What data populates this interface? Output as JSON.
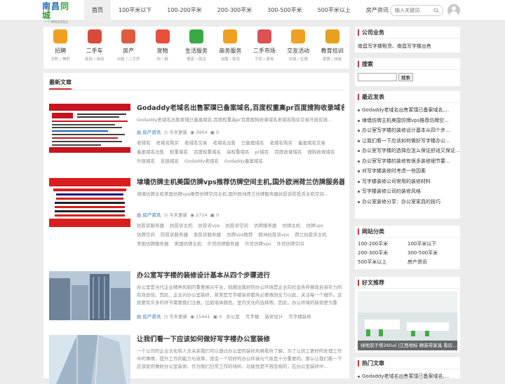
{
  "header": {
    "logo_title_1": "南昌",
    "logo_title_2": "同城",
    "logo_sub": "一个神奇的网站",
    "nav": [
      "首页",
      "100平米以下",
      "100-200平米",
      "200-300平米",
      "300-500平米",
      "500平米以上",
      "房产资讯"
    ],
    "search_placeholder": "输入关键词"
  },
  "categories": [
    {
      "name": "招聘",
      "sub": "全职 / 兼职",
      "color": "#f0a020"
    },
    {
      "name": "二手车",
      "sub": "家用 / 商用",
      "color": "#d84a3a"
    },
    {
      "name": "房产",
      "sub": "出租 / 二手房",
      "color": "#e05a40"
    },
    {
      "name": "宠物",
      "sub": "狗 / 猫",
      "color": "#e8503a"
    },
    {
      "name": "生活服务",
      "sub": "搬家 / 保洁",
      "color": "#3aa845"
    },
    {
      "name": "商务服务",
      "sub": "加盟 / 租赁",
      "color": "#f0a020"
    },
    {
      "name": "二手市场",
      "sub": "手机 / 家电",
      "color": "#e05050"
    },
    {
      "name": "交友活动",
      "sub": "同城 / 征婚",
      "color": "#f0a020"
    },
    {
      "name": "教育培训",
      "sub": "家教 / 技能",
      "color": "#e8a020"
    }
  ],
  "articles_section": "最新文章",
  "articles": [
    {
      "title": "Godaddy老域名出售冢璞已备案域名,百度权重高pr百度搜狗收录域名老...",
      "desc": "Godaddy老域名出售冢璞已备案域名,百度权重高pr百度搜狗收录域名老域名购买交易外链反链...",
      "category": "房产资讯",
      "time": "今天更新",
      "views": "3954",
      "comments": "0",
      "tags": [
        "老域名",
        "老域名购买",
        "老域名交易",
        "老域名出售",
        "已备案域名",
        "老域名购买",
        "备案域名交易",
        "备案域名出售",
        "权重域名",
        "百度权重域名",
        "高权重域名",
        "pr域名",
        "百度收录域名",
        "搜狗收录域名",
        "外链域名",
        "反链域名",
        "Godaddy老域名",
        "Godaddy备案域名"
      ]
    },
    {
      "title": "埭墧仿牌主机美国仿牌vps推荐仿牌空间主机,国外欧洲荷兰仿牌服务器...",
      "desc": "埭墧仿牌主机美国仿牌vps推荐仿牌空间主机,国外欧洲荷兰仿牌服务器抗投诉防投诉主机空间...",
      "category": "房产资讯",
      "time": "今天更新",
      "views": "2714",
      "comments": "0",
      "tags": [
        "抗投诉服务器",
        "抗投诉主机",
        "抗投诉vps",
        "抗投诉空间",
        "仿牌服务器",
        "仿牌主机",
        "仿牌vps",
        "仿牌空间",
        "防投诉服务器",
        "免投诉服务器",
        "仿牌vps推荐",
        "欧洲抗投诉vps",
        "荷兰抗投诉主机",
        "美国仿牌服务器",
        "美国仿牌主机",
        "外贸仿牌服务器",
        "外贸仿牌vps",
        "外贸仿牌空间"
      ]
    },
    {
      "title": "办公室写字楼的装修设计基本从四个步骤进行",
      "desc": "办公室是当代企业精神风貌的重要展示平台，就拥出我好的办公环境是企业向社会各界展现自身实力的有效途径。因此，企业对办公室装修，甚至是写字楼装修都务必要做到全力以赴，关注每一个细节。这就要有许多的环节需要我们注意。比如墙体颜色、室内文化的选择等。因此，办公环境的装修更为重要...",
      "category": "房产资讯",
      "time": "今天更新",
      "views": "15441",
      "comments": "0",
      "tags": [
        "办公室",
        "写字楼",
        "装修设计",
        "写字楼装修"
      ]
    },
    {
      "title": "让我们看一下应该如何做好写字楼办公室装修",
      "desc": "一个公司的企业文化和人文关系我们可以透过办公室的装修风格看所了解，为了让员工更好的处理工作中的事情，提升工作的能力与效率，营造一个较好的办公环境与气氛是十分重要的。那么让我们看一下应该如何做好办公室装修。作为我们日常工作的场所，功能性是不容忽视的，在办公室装修中..."
    }
  ],
  "sidebar": {
    "company_title": "公司业务",
    "company_text": "南昌写字楼租赁、南昌写字楼出售",
    "search_title": "搜索",
    "search_button": "搜索",
    "recent_title": "最近发表",
    "recent": [
      "Godaddy老域名出售冢璞已备案域名,...",
      "埭墧仿牌主机美国仿牌vps推荐仿牌空...",
      "办公室写字楼的装修设计基本从四个步...",
      "让我们看一下应该如何做好写字楼办公...",
      "办公室写字楼的选择应怎么保证舒适又保证...",
      "办公室写字楼的装修有很多装修细节要...",
      "对写字楼装修时考虑一些因素",
      "写字楼装修公司常用的装修材料",
      "写字楼装修公司的装修风格",
      "办公室装修分享：办公室家具的技巧"
    ],
    "class_title": "网站分类",
    "classes": [
      "100-200平米",
      "100平米以下",
      "200-300平米",
      "300-500平米",
      "500平米以上",
      "房产资讯"
    ],
    "friend_title": "好文推荐",
    "friend_caption": "绿地双子塔260㎡ |江西地标 精装带家具 看房...",
    "hot_title": "热门文章",
    "hot": [
      "Godaddy老域名出售冢璞已备案域名,..."
    ]
  }
}
